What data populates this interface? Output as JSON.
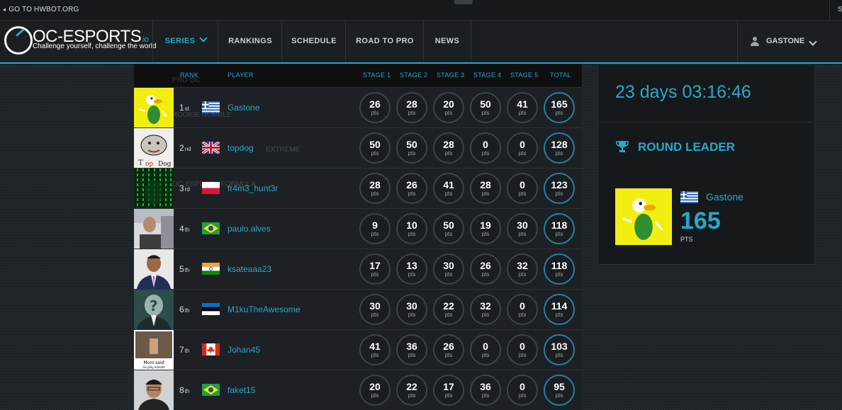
{
  "topbar": {
    "hwbot_link": "GO TO HWBOT.ORG",
    "right_letter": "S"
  },
  "brand": {
    "name": "OC-ESPORTS",
    "suffix": ".io",
    "tagline": "Challenge yourself, challenge the world"
  },
  "nav": {
    "items": [
      {
        "label": "SERIES",
        "active": true
      },
      {
        "label": "RANKINGS"
      },
      {
        "label": "SCHEDULE"
      },
      {
        "label": "ROAD TO PRO"
      },
      {
        "label": "NEWS"
      }
    ],
    "user": "GASTONE"
  },
  "ghost_menu": [
    "PRO OC",
    "ROOKIE RUMBLE",
    "EXTREME",
    "OC-ESPORTS FORMULA"
  ],
  "table": {
    "headers": {
      "rank": "RANK",
      "player": "PLAYER",
      "stage1": "STAGE 1",
      "stage2": "STAGE 2",
      "stage3": "STAGE 3",
      "stage4": "STAGE 4",
      "stage5": "STAGE 5",
      "total": "TOTAL"
    },
    "pts_label": "pts",
    "rows": [
      {
        "rank": "1",
        "suffix": "st",
        "player": "Gastone",
        "flag": "greece",
        "avatar": "duck-icon",
        "stages": [
          "26",
          "28",
          "20",
          "50",
          "41"
        ],
        "total": "165"
      },
      {
        "rank": "2",
        "suffix": "nd",
        "player": "topdog",
        "flag": "uk",
        "avatar": "bulldog-icon",
        "stages": [
          "50",
          "50",
          "28",
          "0",
          "0"
        ],
        "total": "128"
      },
      {
        "rank": "3",
        "suffix": "rd",
        "player": "fr4m3_hunt3r",
        "flag": "poland",
        "avatar": "matrix-icon",
        "stages": [
          "28",
          "26",
          "41",
          "28",
          "0"
        ],
        "total": "123"
      },
      {
        "rank": "4",
        "suffix": "th",
        "player": "paulo.alves",
        "flag": "brazil",
        "avatar": "photo-icon",
        "stages": [
          "9",
          "10",
          "50",
          "19",
          "30"
        ],
        "total": "118"
      },
      {
        "rank": "5",
        "suffix": "th",
        "player": "ksateaaa23",
        "flag": "india",
        "avatar": "photo-icon",
        "stages": [
          "17",
          "13",
          "30",
          "26",
          "32"
        ],
        "total": "118"
      },
      {
        "rank": "6",
        "suffix": "th",
        "player": "M1kuTheAwesome",
        "flag": "estonia",
        "avatar": "question-icon",
        "stages": [
          "30",
          "30",
          "22",
          "32",
          "0"
        ],
        "total": "114"
      },
      {
        "rank": "7",
        "suffix": "th",
        "player": "Johan45",
        "flag": "canada",
        "avatar": "photo-icon",
        "stages": [
          "41",
          "36",
          "26",
          "0",
          "0"
        ],
        "total": "103"
      },
      {
        "rank": "8",
        "suffix": "th",
        "player": "faket15",
        "flag": "brazil",
        "avatar": "photo-icon",
        "stages": [
          "20",
          "22",
          "17",
          "36",
          "0"
        ],
        "total": "95"
      }
    ]
  },
  "avatar_caption": {
    "line1": "Mom said",
    "line2": "Go play outside"
  },
  "timer": "23 days 03:16:46",
  "round_leader": {
    "title": "ROUND LEADER",
    "name": "Gastone",
    "flag": "greece",
    "points": "165",
    "points_label": "PTS"
  },
  "colors": {
    "accent": "#2aa7c9",
    "background": "#1e2327",
    "panel": "#16191c"
  }
}
